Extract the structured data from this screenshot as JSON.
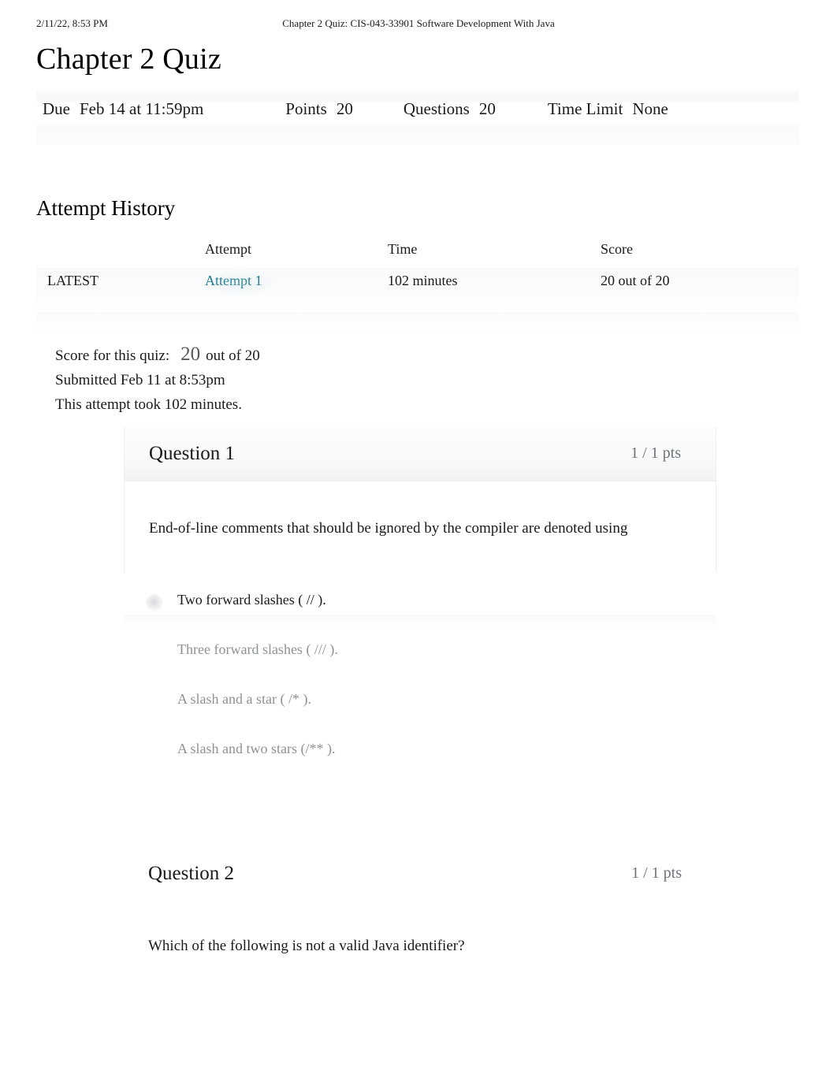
{
  "print_header": {
    "date": "2/11/22, 8:53 PM",
    "title": "Chapter 2 Quiz: CIS-043-33901 Software Development With Java"
  },
  "page_title": "Chapter 2 Quiz",
  "quiz_meta": {
    "due_label": "Due",
    "due_value": "Feb 14 at 11:59pm",
    "points_label": "Points",
    "points_value": "20",
    "questions_label": "Questions",
    "questions_value": "20",
    "time_limit_label": "Time Limit",
    "time_limit_value": "None"
  },
  "attempt_history": {
    "heading": "Attempt History",
    "columns": [
      "",
      "Attempt",
      "Time",
      "Score"
    ],
    "rows": [
      {
        "flag": "LATEST",
        "attempt": "Attempt 1",
        "time": "102 minutes",
        "score": "20 out of 20"
      }
    ]
  },
  "score_summary": {
    "score_label": "Score for this quiz:",
    "score_value": "20",
    "score_out_of": "out of 20",
    "submitted": "Submitted Feb 11 at 8:53pm",
    "duration": "This attempt took 102 minutes."
  },
  "questions": [
    {
      "name": "Question 1",
      "points": "1 / 1 pts",
      "text": "End-of-line comments that should be ignored by the compiler are denoted using",
      "answers": [
        {
          "text": "Two forward slashes ( // ).",
          "selected": true
        },
        {
          "text": "Three forward slashes ( /// ).",
          "selected": false
        },
        {
          "text": "A slash and a star ( /* ).",
          "selected": false
        },
        {
          "text": "A slash and two stars (/** ).",
          "selected": false
        }
      ]
    },
    {
      "name": "Question 2",
      "points": "1 / 1 pts",
      "text": "Which of the following is not a valid Java identifier?",
      "answers": []
    }
  ],
  "colors": {
    "link": "#0a7184",
    "text": "#1a1a1a",
    "muted": "#8c9296",
    "points": "#6d7479",
    "box_border": "#ebedee",
    "header_bg": "#f5f6f7"
  }
}
